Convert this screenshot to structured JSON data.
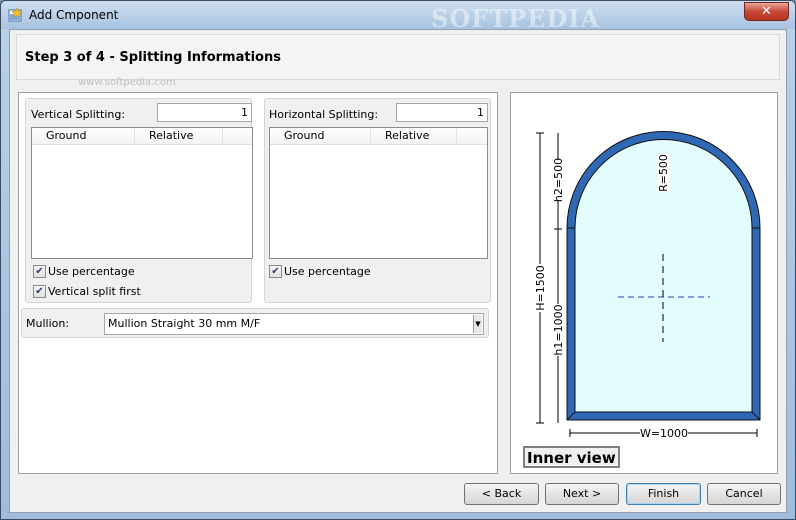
{
  "window": {
    "title": "Add Cmponent",
    "close_glyph": "✕",
    "watermark": "SOFTPEDIA"
  },
  "header": {
    "step_title": "Step 3 of 4 - Splitting Informations",
    "watermark_url": "www.softpedia.com"
  },
  "vertical": {
    "label": "Vertical Splitting:",
    "value": "1",
    "columns": [
      "Ground",
      "Relative"
    ],
    "use_percentage_label": "Use percentage",
    "use_percentage_checked": true,
    "vertical_first_label": "Vertical split first",
    "vertical_first_checked": true
  },
  "horizontal": {
    "label": "Horizontal Splitting:",
    "value": "1",
    "columns": [
      "Ground",
      "Relative"
    ],
    "use_percentage_label": "Use percentage",
    "use_percentage_checked": true
  },
  "mullion": {
    "label": "Mullion:",
    "value": "Mullion Straight 30 mm M/F"
  },
  "drawing": {
    "dim_h2": "h2=500",
    "dim_r": "R=500",
    "dim_H": "H=1500",
    "dim_h1": "h1=1000",
    "dim_w": "W=1000",
    "inner_view_label": "Inner view",
    "frame_color": "#2f68b4",
    "glass_color": "#e3fcfc"
  },
  "buttons": {
    "back": "< Back",
    "next": "Next >",
    "finish": "Finish",
    "cancel": "Cancel"
  }
}
